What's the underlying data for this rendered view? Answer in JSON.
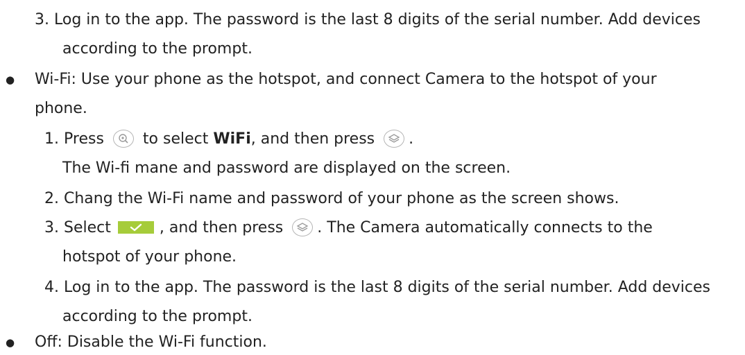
{
  "content": {
    "step3_app": {
      "number": "3.",
      "text": "Log in to the app. The password is the last 8 digits of the serial number. Add devices",
      "cont": "according to the prompt."
    },
    "wifi": {
      "bullet": "●",
      "text": "Wi-Fi: Use your phone as the hotspot, and connect Camera to the hotspot of your",
      "cont": "phone.",
      "steps": [
        {
          "number": "1.",
          "before": "Press",
          "middle": "to select",
          "bold": "WiFi",
          "after": ", and then press",
          "end": ".",
          "note": "The Wi-fi mane and password are displayed on the screen."
        },
        {
          "number": "2.",
          "text": "Chang the Wi-Fi name and password of your phone as the screen shows."
        },
        {
          "number": "3.",
          "before": "Select",
          "after": ", and then press",
          "end": ". The Camera automatically connects to the",
          "cont": "hotspot of your phone."
        },
        {
          "number": "4.",
          "text": "Log in to the app. The password is the last 8 digits of the serial number. Add devices",
          "cont": "according to the prompt."
        }
      ]
    },
    "off": {
      "bullet": "●",
      "text": "Off: Disable the Wi-Fi function."
    }
  },
  "icons": {
    "zoom_button": "zoom-button-icon",
    "ok_button": "ok-button-icon",
    "confirm_check": "check-icon"
  },
  "colors": {
    "text": "#222222",
    "icon_outline": "#b4b4b4",
    "check_green": "#a6cc3a"
  }
}
